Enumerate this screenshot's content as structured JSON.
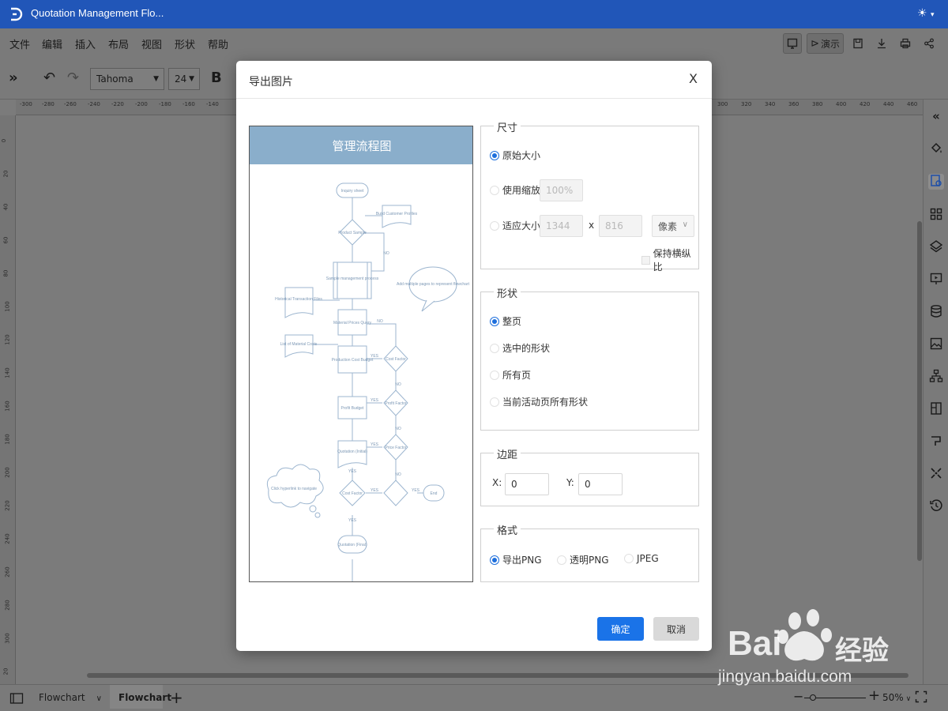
{
  "titlebar": {
    "title": "Quotation Management Flo...",
    "theme_caret": "▾"
  },
  "menu": [
    "文件",
    "编辑",
    "插入",
    "布局",
    "视图",
    "形状",
    "帮助"
  ],
  "topright": {
    "present_label": "演示"
  },
  "toolbar": {
    "font_family": "Tahoma",
    "font_size": "24",
    "bold_label": "B"
  },
  "ruler_top": [
    "-300",
    "-280",
    "-260",
    "-240",
    "-220",
    "-200",
    "-180",
    "-160",
    "-140",
    "300",
    "320",
    "340",
    "360",
    "380",
    "400",
    "420",
    "440",
    "460"
  ],
  "ruler_left": [
    "0",
    "20",
    "40",
    "60",
    "80",
    "100",
    "120",
    "140",
    "160",
    "180",
    "200",
    "220",
    "240",
    "260",
    "280",
    "300",
    "20"
  ],
  "dialog": {
    "title": "导出图片",
    "close": "X",
    "preview": {
      "header": "管理流程图",
      "nodes": [
        "Inquiry sheet",
        "Build Customer Profiles",
        "Product Sample",
        "Sample management process",
        "Add multiple pages to represent flowchart",
        "Historical Transaction Files",
        "Material Prices Query",
        "List of Material Costs",
        "Production Cost Budget",
        "Cost Factor",
        "Profit Budget",
        "Profit Factor",
        "Quotation (Initial)",
        "Price Factor",
        "Click hyperlink to navigate",
        "Cost Factor",
        "End",
        "Quotation (Final)"
      ],
      "labels": {
        "no": "NO",
        "yes": "YES"
      }
    },
    "size": {
      "legend": "尺寸",
      "original": "原始大小",
      "scale": "使用缩放",
      "scale_value": "100%",
      "fit": "适应大小",
      "width": "1344",
      "x": "x",
      "height": "816",
      "unit": "像素",
      "unit_caret": "∨",
      "keep_ratio": "保持横纵比"
    },
    "shape": {
      "legend": "形状",
      "whole_page": "整页",
      "selected": "选中的形状",
      "all_pages": "所有页",
      "current_page": "当前活动页所有形状"
    },
    "margin": {
      "legend": "边距",
      "x_label": "X:",
      "x_value": "0",
      "y_label": "Y:",
      "y_value": "0"
    },
    "format": {
      "legend": "格式",
      "png": "导出PNG",
      "transparent_png": "透明PNG",
      "jpeg": "JPEG"
    },
    "ok": "确定",
    "cancel": "取消"
  },
  "bottombar": {
    "page_select": "Flowchart",
    "page_caret": "∨",
    "page_tab": "Flowchart",
    "zoom": "50%",
    "zoom_caret": "∨"
  },
  "watermark": {
    "brand": "Bai",
    "brand2": "经验",
    "url": "jingyan.baidu.com"
  }
}
